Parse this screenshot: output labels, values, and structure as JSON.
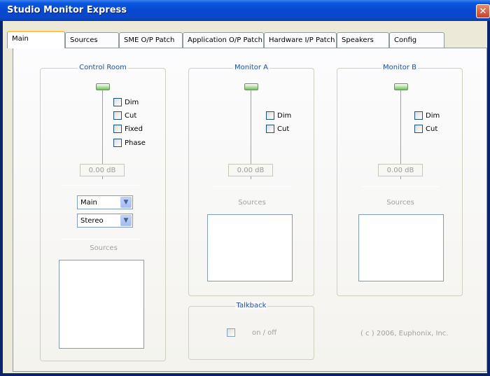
{
  "window": {
    "title": "Studio Monitor Express",
    "close_glyph": "✕"
  },
  "tabs": [
    {
      "label": "Main",
      "active": true
    },
    {
      "label": "Sources"
    },
    {
      "label": "SME O/P Patch"
    },
    {
      "label": "Application O/P Patch"
    },
    {
      "label": "Hardware I/P Patch"
    },
    {
      "label": "Speakers"
    },
    {
      "label": "Config"
    }
  ],
  "control_room": {
    "title": "Control Room",
    "checkboxes": [
      "Dim",
      "Cut",
      "Fixed",
      "Phase"
    ],
    "level": "0.00 dB",
    "select1": "Main",
    "select2": "Stereo",
    "sources_label": "Sources"
  },
  "monitor_a": {
    "title": "Monitor A",
    "checkboxes": [
      "Dim",
      "Cut"
    ],
    "level": "0.00 dB",
    "sources_label": "Sources"
  },
  "monitor_b": {
    "title": "Monitor B",
    "checkboxes": [
      "Dim",
      "Cut"
    ],
    "level": "0.00 dB",
    "sources_label": "Sources"
  },
  "talkback": {
    "title": "Talkback",
    "toggle_label": "on / off"
  },
  "footer": {
    "copyright": "( c ) 2006, Euphonix, Inc."
  },
  "icons": {
    "dropdown_arrow": "▼"
  },
  "colors": {
    "title_bar": "#0847d1",
    "group_title": "#1f4fa0",
    "slider_thumb": "#6fc25b"
  }
}
